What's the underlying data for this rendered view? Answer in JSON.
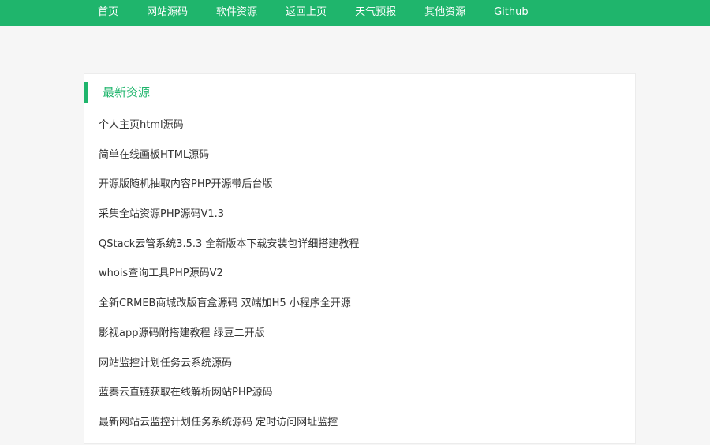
{
  "nav": {
    "items": [
      "首页",
      "网站源码",
      "软件资源",
      "返回上页",
      "天气预报",
      "其他资源",
      "Github"
    ]
  },
  "panel": {
    "title": "最新资源",
    "items": [
      "个人主页html源码",
      "简单在线画板HTML源码",
      "开源版随机抽取内容PHP开源带后台版",
      "采集全站资源PHP源码V1.3",
      "QStack云管系统3.5.3 全新版本下载安装包详细搭建教程",
      "whois查询工具PHP源码V2",
      "全新CRMEB商城改版盲盒源码 双端加H5 小程序全开源",
      "影视app源码附搭建教程 绿豆二开版",
      "网站监控计划任务云系统源码",
      "蓝奏云直链获取在线解析网站PHP源码",
      "最新网站云监控计划任务系统源码 定时访问网址监控"
    ]
  },
  "colors": {
    "accent": "#1fb56c",
    "text": "#333333",
    "background": "#f6f6f6"
  }
}
